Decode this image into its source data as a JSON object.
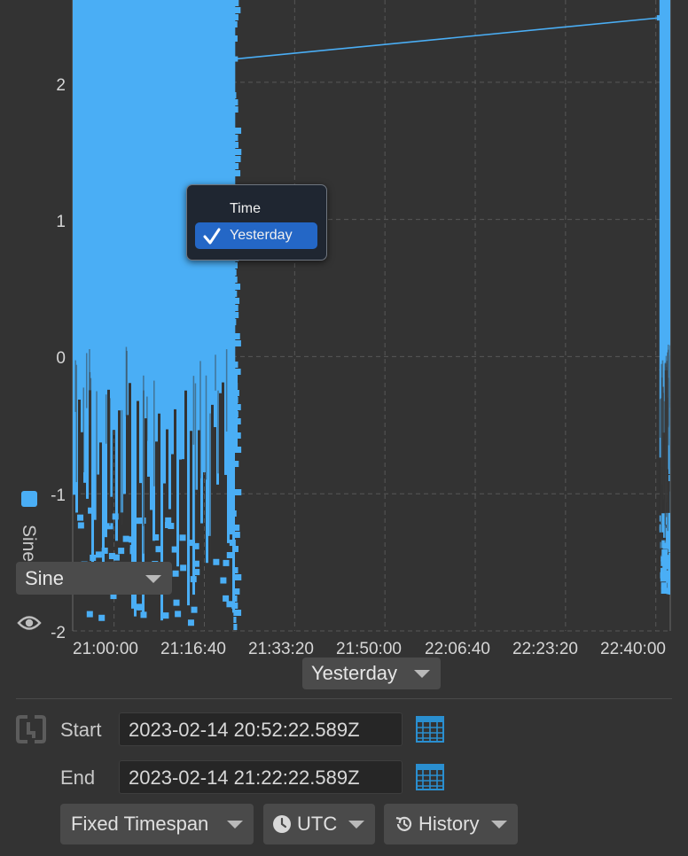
{
  "chart_data": {
    "type": "scatter",
    "title": "",
    "xlabel": "Yesterday",
    "ylabel": "",
    "ylim": [
      -2,
      2.6
    ],
    "xlim": [
      "20:52:22",
      "22:42:40"
    ],
    "y_ticks": [
      "2",
      "1",
      "0",
      "-1",
      "-2"
    ],
    "x_ticks": [
      "21:00:00",
      "21:16:40",
      "21:33:20",
      "21:50:00",
      "22:06:40",
      "22:23:20",
      "22:40:00"
    ],
    "grid": true,
    "legend_placement": "left",
    "series": [
      {
        "name": "Sine",
        "color": "#4aaef5",
        "dense_bands": [
          {
            "x_start": "20:52:22",
            "x_end": "21:22:22",
            "y_min": -1.95,
            "y_max": 2.6
          },
          {
            "x_start": "22:40:40",
            "x_end": "22:42:40",
            "y_min": -1.7,
            "y_max": 2.6
          }
        ],
        "points": [
          {
            "x": "21:22:22",
            "y": 2.17
          },
          {
            "x": "22:40:40",
            "y": 2.47
          }
        ]
      }
    ]
  },
  "legend": {
    "series_name": "Sine",
    "swatch_color": "#4aaef5",
    "series_select_value": "Sine",
    "visibility_icon": "eye-icon"
  },
  "x_axis_select": {
    "value": "Yesterday"
  },
  "x_axis_menu": {
    "header": "Time",
    "items": [
      {
        "label": "Yesterday",
        "checked": true
      }
    ]
  },
  "timespan": {
    "start_label": "Start",
    "start_value": "2023-02-14 20:52:22.589Z",
    "end_label": "End",
    "end_value": "2023-02-14 21:22:22.589Z",
    "sync_icon": "link-bracket-icon",
    "calendar_icon": "calendar-icon"
  },
  "toolbar": {
    "mode_label": "Fixed Timespan",
    "timezone_label": "UTC",
    "history_label": "History",
    "clock_icon": "clock-icon",
    "history_icon": "history-icon"
  }
}
